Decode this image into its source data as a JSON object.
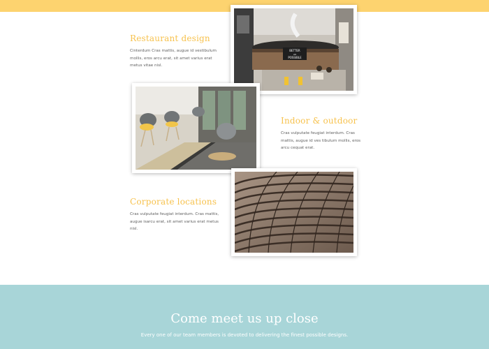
{
  "features": [
    {
      "title": "Restaurant design",
      "text_lines": [
        "Cinterdum Cras mattis, augue id vestibulum",
        "mollis, eros arcu erat, sit amet varius erat",
        "metus vitae nisl."
      ]
    },
    {
      "title": "Indoor & outdoor",
      "text_lines": [
        "Cras vulputate feugiat interdum. Cras",
        "mattis, augue id ves tibulum mollis, eros",
        "arcu cequat erat."
      ]
    },
    {
      "title": "Corporate locations",
      "text_lines": [
        "Cras vulputate feugiat interdum. Cras mattis,",
        "augue isarcu erat, sit amet varius erat metus",
        "nisl."
      ]
    }
  ],
  "photos": {
    "restaurant_sign": "BETTER\nAS\nPOSSIBLE"
  },
  "cta": {
    "title": "Come meet us up close",
    "subtitle": "Every one of our team members is devoted to delivering the finest possible designs."
  },
  "colors": {
    "top_bar": "#fdd36f",
    "accent_title": "#f7c24e",
    "cta_band": "#a8d5d8",
    "body_text": "#5f5f5f"
  }
}
